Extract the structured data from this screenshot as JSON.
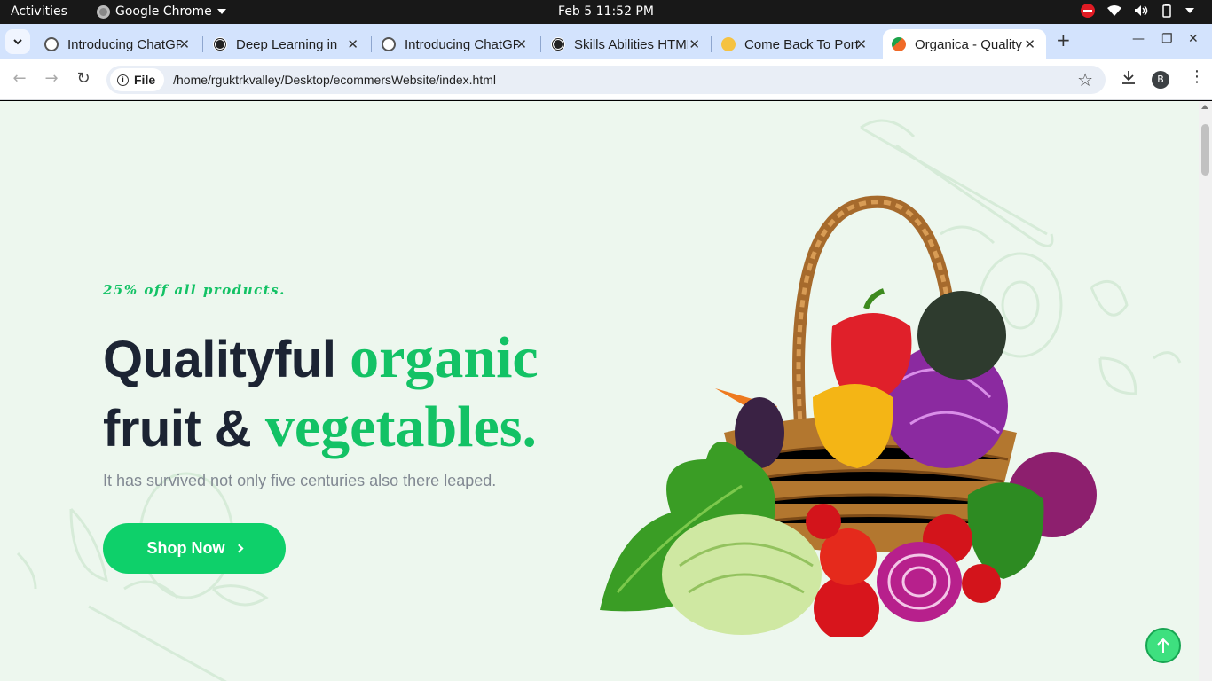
{
  "system_bar": {
    "activities": "Activities",
    "app_name": "Google Chrome",
    "clock": "Feb 5  11:52 PM"
  },
  "browser": {
    "tabs": [
      {
        "title": "Introducing ChatGPT",
        "favicon": "openai-icon",
        "active": false
      },
      {
        "title": "Deep Learning in",
        "favicon": "deep-learning-icon",
        "active": false
      },
      {
        "title": "Introducing ChatGPT",
        "favicon": "openai-icon",
        "active": false
      },
      {
        "title": "Skills Abilities HTML",
        "favicon": "openai-icon",
        "active": false
      },
      {
        "title": "Come Back To Portfolio",
        "favicon": "praying-hands-icon",
        "active": false
      },
      {
        "title": "Organica - Quality",
        "favicon": "organica-icon",
        "active": true
      }
    ],
    "address_chip": "File",
    "url": "/home/rguktrkvalley/Desktop/ecommersWebsite/index.html",
    "profile_initial": "B"
  },
  "page": {
    "promo": "25% off all products.",
    "headline": {
      "line1_dark": "Qualityful",
      "line1_green": "organic",
      "line2_dark": "fruit &",
      "line2_green": "vegetables."
    },
    "subtext": "It has survived not only five centuries also there leaped.",
    "cta_label": "Shop Now",
    "hero_image": "basket of vegetables"
  },
  "colors": {
    "accent": "#0ed06a",
    "heading": "#1c2433",
    "page_bg": "#edf7ee"
  }
}
